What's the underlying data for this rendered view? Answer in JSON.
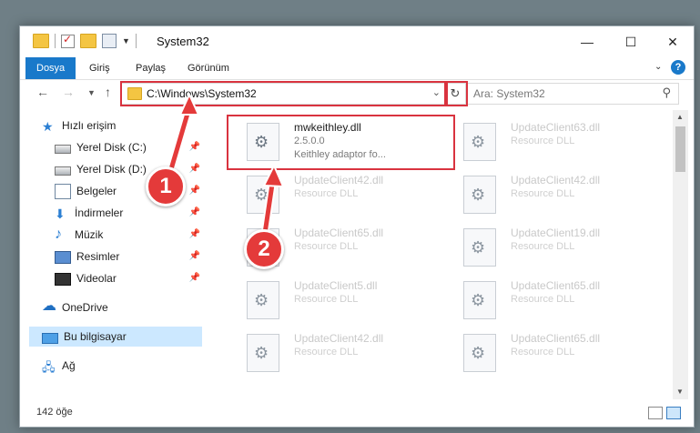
{
  "window": {
    "title": "System32",
    "controls": {
      "minimize": "—",
      "maximize": "☐",
      "close": "✕"
    }
  },
  "ribbon": {
    "tabs": [
      "Dosya",
      "Giriş",
      "Paylaş",
      "Görünüm"
    ],
    "help": "?"
  },
  "navigation": {
    "address": "C:\\Windows\\System32",
    "search_placeholder": "Ara: System32"
  },
  "sidebar": {
    "items": [
      {
        "label": "Hızlı erişim",
        "icon": "star-icon"
      },
      {
        "label": "Yerel Disk (C:)",
        "icon": "drive-icon",
        "pinned": true
      },
      {
        "label": "Yerel Disk (D:)",
        "icon": "drive-icon",
        "pinned": true
      },
      {
        "label": "Belgeler",
        "icon": "documents-icon",
        "pinned": true
      },
      {
        "label": "İndirmeler",
        "icon": "downloads-icon",
        "pinned": true
      },
      {
        "label": "Müzik",
        "icon": "music-icon",
        "pinned": true
      },
      {
        "label": "Resimler",
        "icon": "pictures-icon",
        "pinned": true
      },
      {
        "label": "Videolar",
        "icon": "videos-icon",
        "pinned": true
      },
      {
        "label": "OneDrive",
        "icon": "onedrive-icon"
      },
      {
        "label": "Bu bilgisayar",
        "icon": "this-pc-icon",
        "selected": true
      },
      {
        "label": "Ağ",
        "icon": "network-icon"
      }
    ]
  },
  "files": [
    {
      "name": "mwkeithley.dll",
      "line2": "2.5.0.0",
      "line3": "Keithley adaptor fo..."
    },
    {
      "name": "UpdateClient63.dll",
      "line2": "Resource DLL"
    },
    {
      "name": "UpdateClient42.dll",
      "line2": "Resource DLL"
    },
    {
      "name": "UpdateClient42.dll",
      "line2": "Resource DLL"
    },
    {
      "name": "UpdateClient65.dll",
      "line2": "Resource DLL"
    },
    {
      "name": "UpdateClient19.dll",
      "line2": "Resource DLL"
    },
    {
      "name": "UpdateClient5.dll",
      "line2": "Resource DLL"
    },
    {
      "name": "UpdateClient65.dll",
      "line2": "Resource DLL"
    },
    {
      "name": "UpdateClient42.dll",
      "line2": "Resource DLL"
    },
    {
      "name": "UpdateClient65.dll",
      "line2": "Resource DLL"
    }
  ],
  "status": {
    "count": "142 öğe"
  },
  "annotations": {
    "step1": "1",
    "step2": "2",
    "highlight_color": "#d9333f"
  }
}
